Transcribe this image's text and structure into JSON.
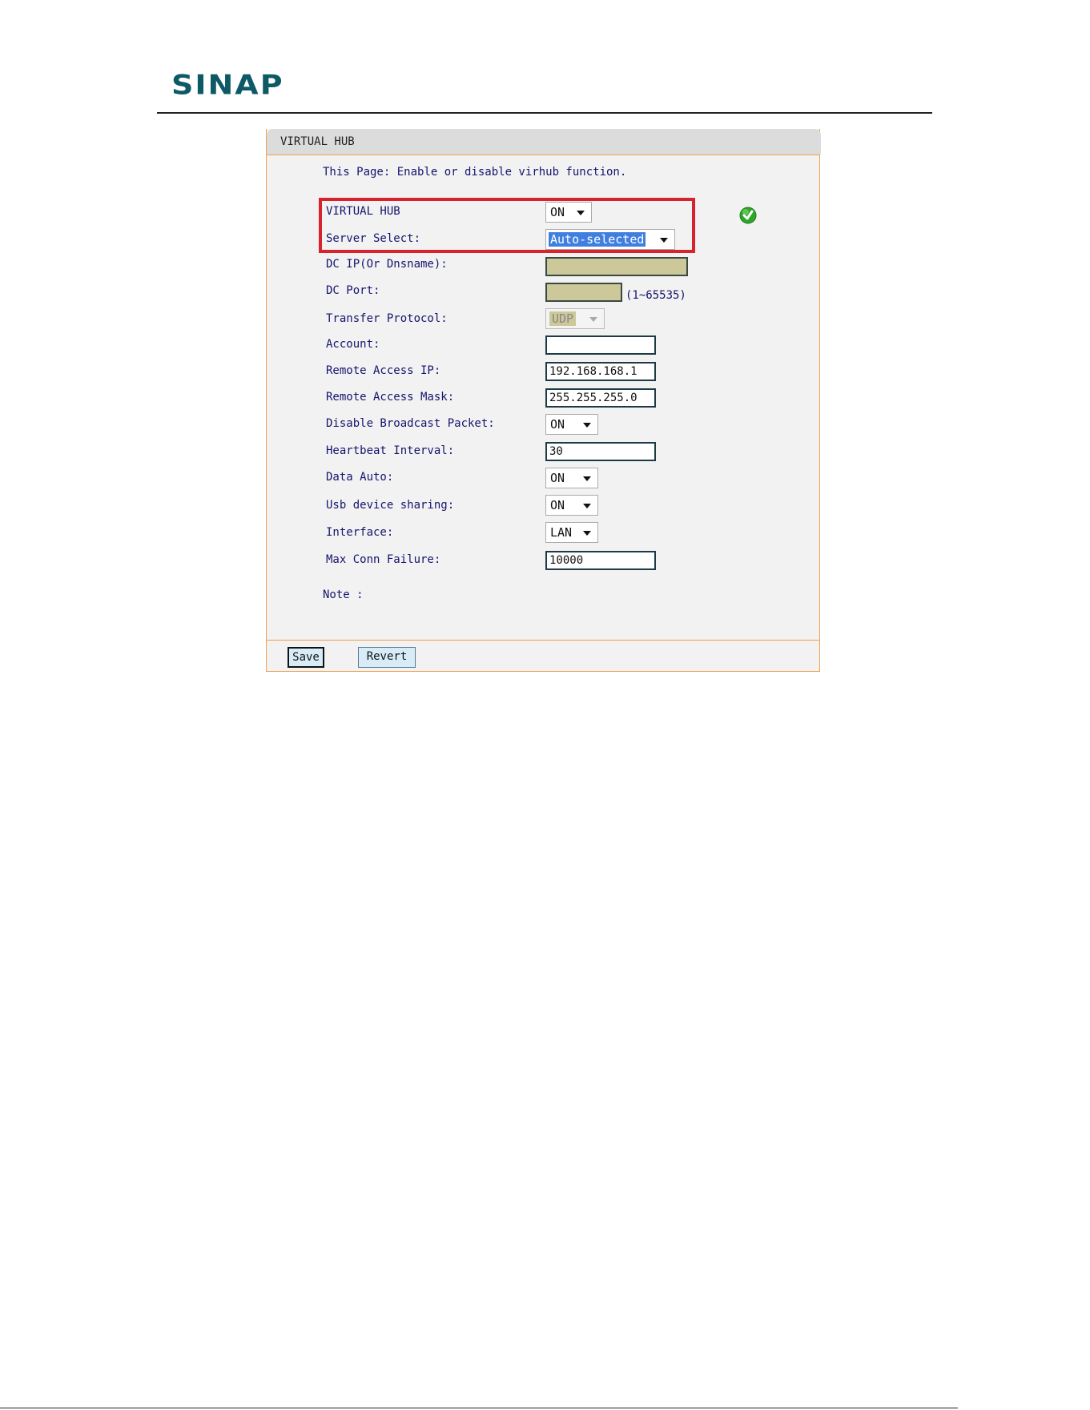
{
  "brand": {
    "logo_text": "SINAP"
  },
  "panel": {
    "title": "VIRTUAL HUB",
    "description": "This Page: Enable or disable virhub function.",
    "note_label": "Note :"
  },
  "form": {
    "virtual_hub": {
      "label": "VIRTUAL HUB",
      "value": "ON"
    },
    "server_select": {
      "label": "Server Select:",
      "value": "Auto-selected"
    },
    "dc_ip": {
      "label": "DC IP(Or Dnsname):",
      "value": ""
    },
    "dc_port": {
      "label": "DC Port:",
      "value": "",
      "hint": "(1~65535)"
    },
    "transfer_protocol": {
      "label": "Transfer Protocol:",
      "value": "UDP"
    },
    "account": {
      "label": "Account:",
      "value": ""
    },
    "remote_access_ip": {
      "label": "Remote Access IP:",
      "value": "192.168.168.1"
    },
    "remote_access_mask": {
      "label": "Remote Access Mask:",
      "value": "255.255.255.0"
    },
    "disable_broadcast": {
      "label": "Disable Broadcast Packet:",
      "value": "ON"
    },
    "heartbeat_interval": {
      "label": "Heartbeat Interval:",
      "value": "30"
    },
    "data_auto": {
      "label": "Data Auto:",
      "value": "ON"
    },
    "usb_sharing": {
      "label": "Usb device sharing:",
      "value": "ON"
    },
    "interface": {
      "label": "Interface:",
      "value": "LAN"
    },
    "max_conn_failure": {
      "label": "Max Conn Failure:",
      "value": "10000"
    }
  },
  "buttons": {
    "save": "Save",
    "revert": "Revert"
  },
  "icons": {
    "status": "check-circle-icon"
  },
  "colors": {
    "brand": "#0d5a66",
    "highlight_box": "#d7232e",
    "panel_border": "#f0a050",
    "label_text": "#14146e",
    "selection": "#3f7fe0",
    "disabled_fill": "#ccc89a"
  }
}
